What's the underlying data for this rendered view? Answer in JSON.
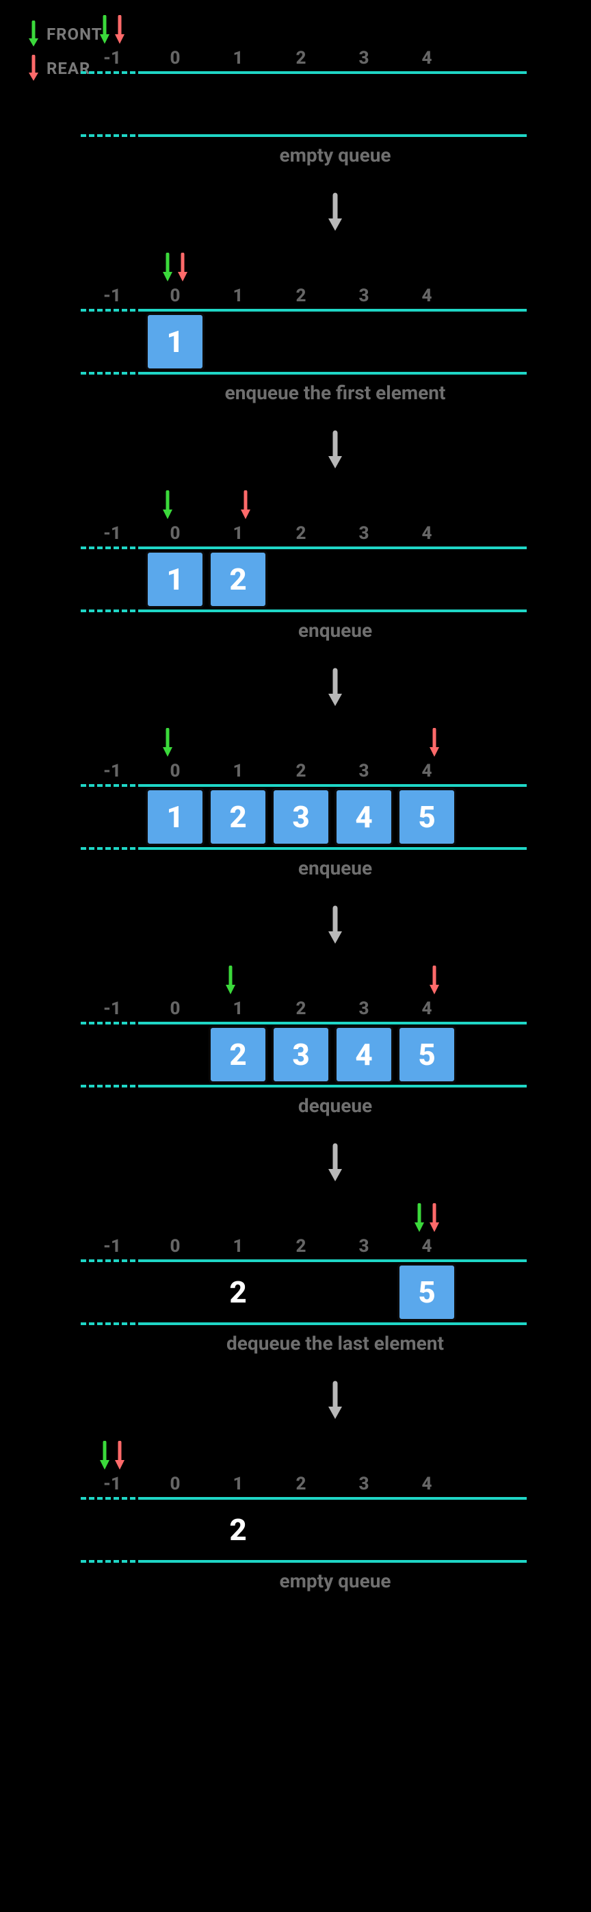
{
  "legend": {
    "front": "FRONT",
    "rear": "REAR"
  },
  "colors": {
    "front": "#3bd93b",
    "rear": "#ff6a6a",
    "rail": "#1fd6c6",
    "box": "#5aa8ec",
    "flow": "#b8b8b8"
  },
  "indexLabels": [
    "-1",
    "0",
    "1",
    "2",
    "3",
    "4"
  ],
  "chart_data": [
    {
      "front": -1,
      "rear": -1,
      "cells": [
        null,
        null,
        null,
        null,
        null
      ],
      "ghost": null,
      "caption": "empty queue"
    },
    {
      "front": 0,
      "rear": 0,
      "cells": [
        "1",
        null,
        null,
        null,
        null
      ],
      "ghost": null,
      "caption": "enqueue the first element"
    },
    {
      "front": 0,
      "rear": 1,
      "cells": [
        "1",
        "2",
        null,
        null,
        null
      ],
      "ghost": null,
      "caption": "enqueue"
    },
    {
      "front": 0,
      "rear": 4,
      "cells": [
        "1",
        "2",
        "3",
        "4",
        "5"
      ],
      "ghost": null,
      "caption": "enqueue"
    },
    {
      "front": 1,
      "rear": 4,
      "cells": [
        null,
        "2",
        "3",
        "4",
        "5"
      ],
      "ghost": null,
      "caption": "dequeue"
    },
    {
      "front": 4,
      "rear": 4,
      "cells": [
        null,
        null,
        null,
        null,
        "5"
      ],
      "ghost": {
        "index": 1,
        "value": "2"
      },
      "caption": "dequeue the last element"
    },
    {
      "front": -1,
      "rear": -1,
      "cells": [
        null,
        null,
        null,
        null,
        null
      ],
      "ghost": {
        "index": 1,
        "value": "2"
      },
      "caption": "empty queue"
    }
  ]
}
